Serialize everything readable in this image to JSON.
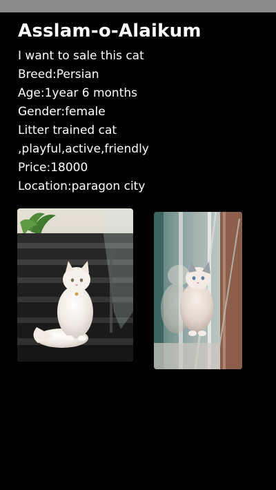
{
  "post": {
    "title": "Asslam-o-Alaikum",
    "lines": [
      "I want to sale this cat",
      "Breed:Persian",
      "Age:1year 6 months",
      "Gender:female",
      "Litter trained cat",
      ",playful,active,friendly",
      "Price:18000",
      "Location:paragon city"
    ]
  },
  "photos": [
    {
      "subject": "white-persian-cat-on-stairs",
      "accent": "#efe9e2"
    },
    {
      "subject": "white-persian-cat-at-window",
      "accent": "#d8cfc8"
    }
  ],
  "colors": {
    "background": "#000000",
    "text": "#ffffff",
    "status_bar": "#8a8a8a"
  }
}
